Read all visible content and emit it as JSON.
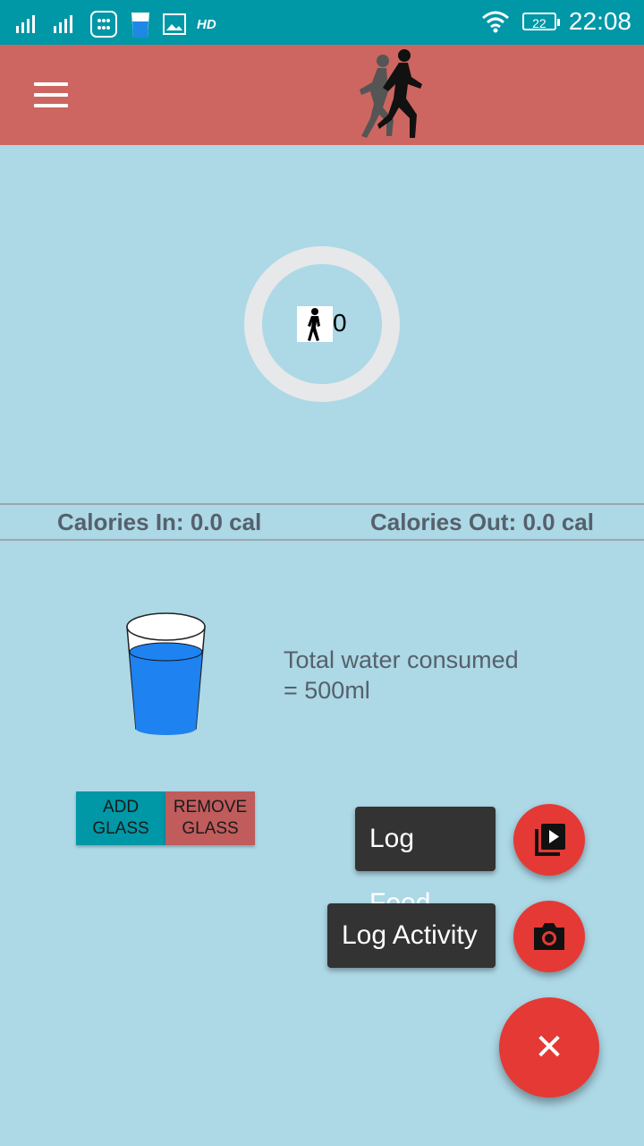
{
  "status_bar": {
    "network_label": "HD",
    "battery": "22",
    "time": "22:08"
  },
  "app_bar": {
    "menu_icon": "hamburger-menu-icon",
    "logo_icon": "runners-logo-icon"
  },
  "activity": {
    "steps": "0",
    "steps_icon": "walking-person-icon"
  },
  "calories": {
    "in_label": "Calories In: 0.0 cal",
    "out_label": "Calories Out: 0.0 cal"
  },
  "water": {
    "total_line1": "Total water consumed",
    "total_line2": "= 500ml",
    "add_line1": "ADD",
    "add_line2": "GLASS",
    "remove_line1": "REMOVE",
    "remove_line2": "GLASS"
  },
  "fab_menu": {
    "log_food": "Log Food",
    "log_activity": "Log Activity",
    "close_symbol": "✕"
  },
  "colors": {
    "status_bar": "#0097a7",
    "app_bar": "#cd6660",
    "background": "#add8e6",
    "fab": "#e53935",
    "add_button": "#0097a7",
    "remove_button": "#c05c5c"
  }
}
